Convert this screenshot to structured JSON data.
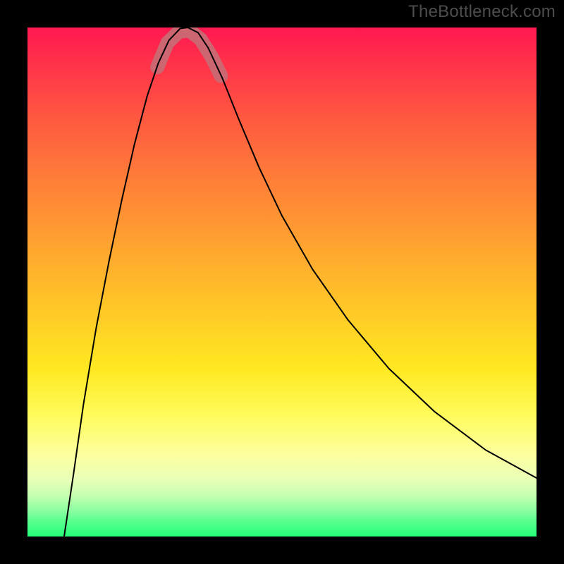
{
  "watermark": {
    "text": "TheBottleneck.com"
  },
  "chart_data": {
    "type": "line",
    "title": "",
    "xlabel": "",
    "ylabel": "",
    "x_range_frac": [
      0,
      1
    ],
    "y_range_frac": [
      0,
      1
    ],
    "gradient_stops": [
      {
        "pos": 0.0,
        "color": "#ff1850"
      },
      {
        "pos": 0.08,
        "color": "#ff3549"
      },
      {
        "pos": 0.18,
        "color": "#ff5940"
      },
      {
        "pos": 0.3,
        "color": "#ff7e38"
      },
      {
        "pos": 0.42,
        "color": "#ffa130"
      },
      {
        "pos": 0.55,
        "color": "#ffc728"
      },
      {
        "pos": 0.67,
        "color": "#ffe821"
      },
      {
        "pos": 0.76,
        "color": "#fffb5a"
      },
      {
        "pos": 0.84,
        "color": "#fcffa0"
      },
      {
        "pos": 0.89,
        "color": "#e8ffb8"
      },
      {
        "pos": 0.92,
        "color": "#c4ffb0"
      },
      {
        "pos": 0.95,
        "color": "#8affa0"
      },
      {
        "pos": 0.97,
        "color": "#59ff8e"
      },
      {
        "pos": 0.99,
        "color": "#36ff80"
      },
      {
        "pos": 1.0,
        "color": "#24ff78"
      }
    ],
    "series": [
      {
        "name": "main-curve",
        "stroke": "#000000",
        "stroke_width_px": 2,
        "points_frac": [
          {
            "x": 0.072,
            "y": 0.0
          },
          {
            "x": 0.09,
            "y": 0.12
          },
          {
            "x": 0.11,
            "y": 0.26
          },
          {
            "x": 0.135,
            "y": 0.41
          },
          {
            "x": 0.16,
            "y": 0.54
          },
          {
            "x": 0.185,
            "y": 0.66
          },
          {
            "x": 0.21,
            "y": 0.77
          },
          {
            "x": 0.235,
            "y": 0.865
          },
          {
            "x": 0.257,
            "y": 0.93
          },
          {
            "x": 0.278,
            "y": 0.975
          },
          {
            "x": 0.3,
            "y": 0.998
          },
          {
            "x": 0.315,
            "y": 1.0
          },
          {
            "x": 0.335,
            "y": 0.99
          },
          {
            "x": 0.355,
            "y": 0.96
          },
          {
            "x": 0.383,
            "y": 0.9
          },
          {
            "x": 0.415,
            "y": 0.82
          },
          {
            "x": 0.455,
            "y": 0.725
          },
          {
            "x": 0.5,
            "y": 0.63
          },
          {
            "x": 0.56,
            "y": 0.525
          },
          {
            "x": 0.63,
            "y": 0.425
          },
          {
            "x": 0.71,
            "y": 0.33
          },
          {
            "x": 0.8,
            "y": 0.245
          },
          {
            "x": 0.9,
            "y": 0.17
          },
          {
            "x": 1.0,
            "y": 0.115
          }
        ]
      },
      {
        "name": "highlight-valley",
        "stroke": "#cc6670",
        "stroke_width_px": 20,
        "linecap": "round",
        "points_frac": [
          {
            "x": 0.255,
            "y": 0.922
          },
          {
            "x": 0.275,
            "y": 0.97
          },
          {
            "x": 0.298,
            "y": 0.992
          },
          {
            "x": 0.318,
            "y": 0.994
          },
          {
            "x": 0.34,
            "y": 0.977
          },
          {
            "x": 0.362,
            "y": 0.942
          },
          {
            "x": 0.38,
            "y": 0.905
          }
        ]
      }
    ]
  }
}
